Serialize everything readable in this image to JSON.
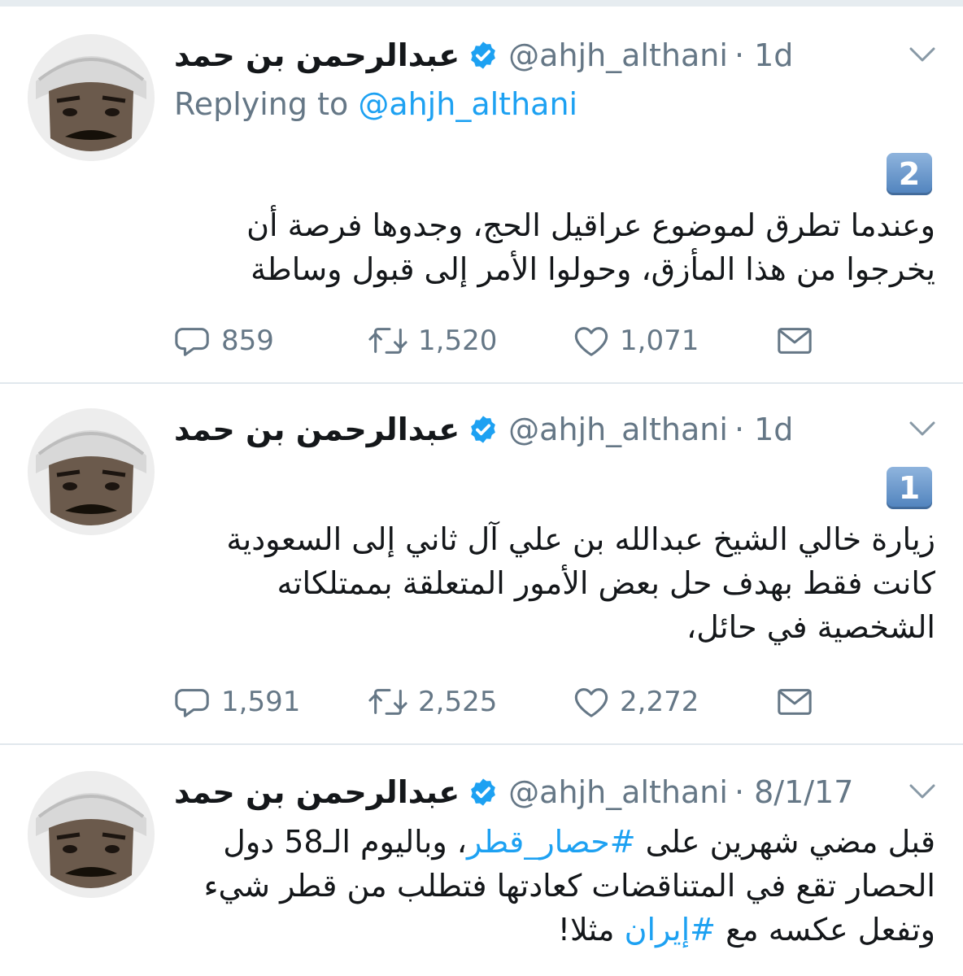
{
  "colors": {
    "link": "#1da1f2",
    "muted": "#657786",
    "divider": "#e1e8ed",
    "text": "#14171a"
  },
  "tweets": [
    {
      "name": "عبدالرحمن بن حمد",
      "handle": "@ahjh_althani",
      "time": "· 1d",
      "replying_prefix": "Replying to ",
      "replying_to": "@ahjh_althani",
      "badge": "2",
      "text_lines": [
        "وعندما تطرق لموضوع عراقيل الحج، وجدوها فرصة أن",
        "يخرجوا من هذا المأزق، وحولوا الأمر إلى قبول وساطة"
      ],
      "replies": "859",
      "retweets": "1,520",
      "likes": "1,071",
      "icons": [
        "reply-icon",
        "retweet-icon",
        "like-icon",
        "message-icon"
      ]
    },
    {
      "name": "عبدالرحمن بن حمد",
      "handle": "@ahjh_althani",
      "time": "· 1d",
      "badge": "1",
      "text_lines": [
        "زيارة خالي الشيخ عبدالله بن علي آل ثاني إلى السعودية",
        "كانت فقط بهدف حل بعض الأمور المتعلقة بممتلكاته",
        "الشخصية في حائل،"
      ],
      "replies": "1,591",
      "retweets": "2,525",
      "likes": "2,272"
    },
    {
      "name": "عبدالرحمن بن حمد",
      "handle": "@ahjh_althani",
      "time": "· 8/1/17",
      "line1_a": "قبل مضي شهرين على ",
      "line1_hashtag": "#حصار_قطر",
      "line1_b": "، وباليوم الـ58 دول",
      "line2": "الحصار تقع في المتناقضات كعادتها فتطلب من قطر شيء",
      "line3_a": "وتفعل عكسه مع ",
      "line3_hashtag": "#إيران",
      "line3_b": " مثلا!"
    }
  ]
}
